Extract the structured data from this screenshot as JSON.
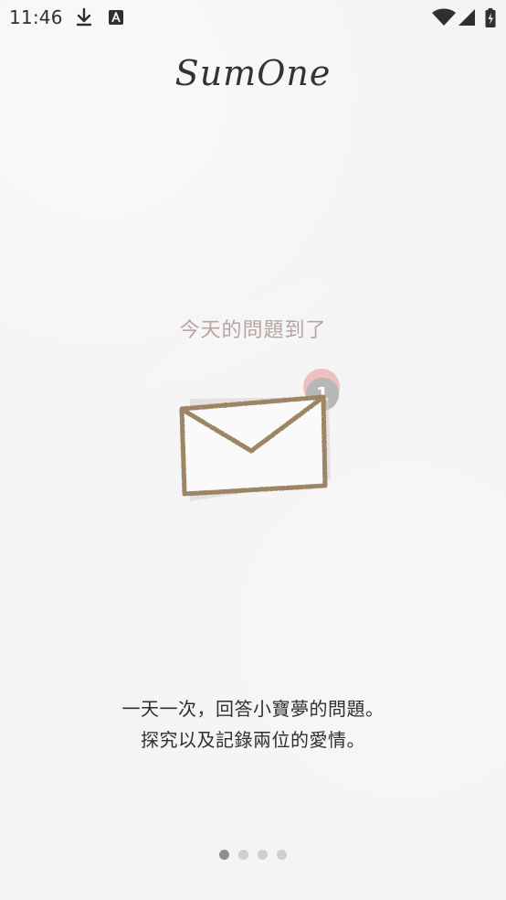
{
  "status_bar": {
    "time": "11:46",
    "icons_left": [
      "download-icon",
      "a-box-icon"
    ],
    "icons_right": [
      "wifi-icon",
      "cell-signal-icon",
      "battery-charging-icon"
    ]
  },
  "app": {
    "logo_text": "SumOne"
  },
  "slide": {
    "title": "今天的問題到了",
    "badge_count": "1",
    "description_lines": [
      "一天一次，回答小寶夢的問題。",
      "探究以及記錄兩位的愛情。"
    ]
  },
  "pager": {
    "count": 4,
    "active_index": 0
  },
  "colors": {
    "background": "#f4f4f4",
    "title": "#b9a3a3",
    "envelope_stroke": "#9c8565",
    "badge": "#b7b7b7",
    "badge_accent": "#e89494",
    "dot_active": "#8e8e8e",
    "dot_inactive": "#cfcfcf"
  }
}
